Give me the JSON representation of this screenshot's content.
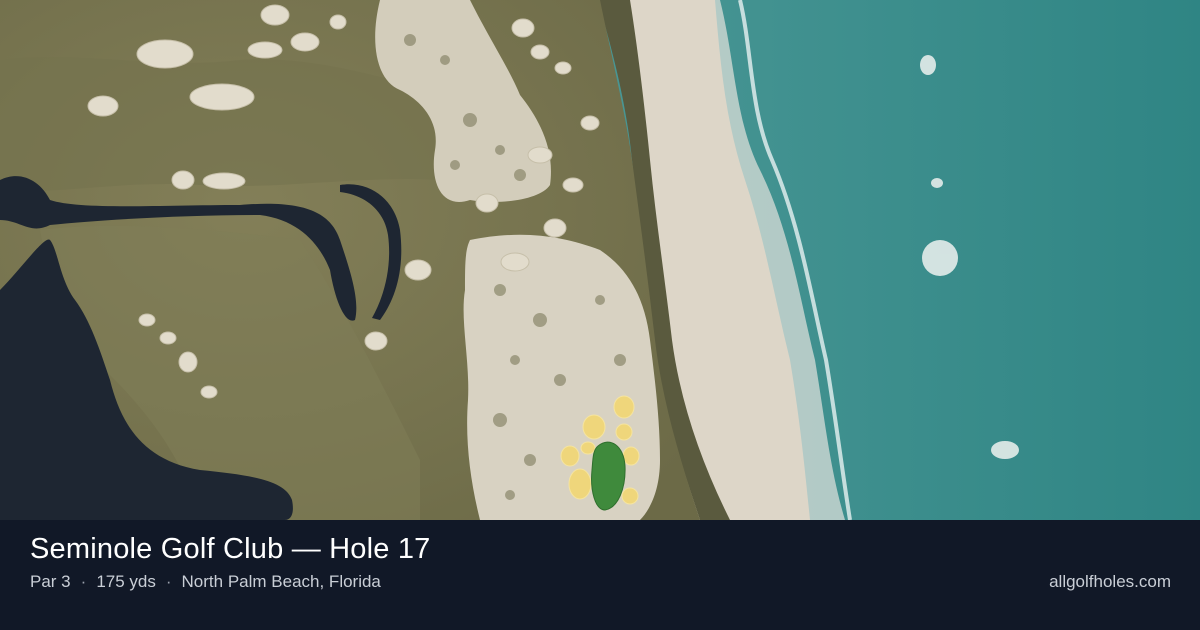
{
  "course": {
    "title": "Seminole Golf Club — Hole 17",
    "par": "Par 3",
    "yardage": "175 yds",
    "location": "North Palm Beach, Florida",
    "separator": "·"
  },
  "site": {
    "label": "allgolfholes.com"
  },
  "colors": {
    "footer_bg": "#111827",
    "ocean": "#4e9a98",
    "fairway": "#7d7b55",
    "rough": "#6b6a47",
    "water_hazard": "#1e2632",
    "sand": "#d8d2c2",
    "beach": "#ddd6c8",
    "green_highlight": "#3f8a3c",
    "bunker_highlight": "#e8d37a"
  },
  "map": {
    "view": "aerial satellite",
    "layers": [
      "ocean-layer",
      "beach-layer",
      "dune-vegetation",
      "course-turf",
      "waste-sand",
      "water-hazard",
      "bunkers",
      "highlighted-green",
      "highlighted-bunkers"
    ]
  }
}
